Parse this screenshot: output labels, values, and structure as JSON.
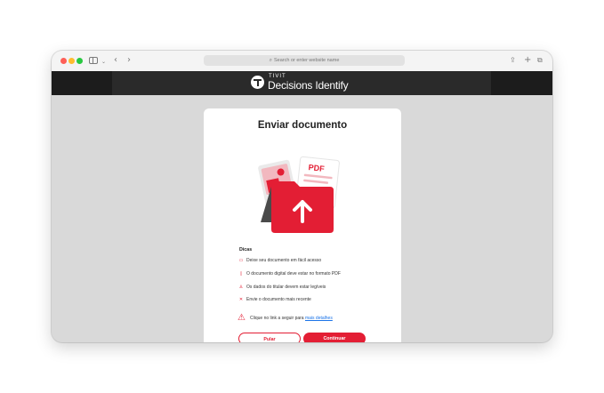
{
  "browser": {
    "url_placeholder": "Search or enter website name"
  },
  "header": {
    "brand_top": "TIVIT",
    "brand_bottom": "Decisions Identify"
  },
  "card": {
    "title": "Enviar documento",
    "illustration_label": "PDF",
    "tips_title": "Dicas",
    "tips": [
      {
        "icon": "folder-icon",
        "text": "Deixe seu documento em fácil acesso"
      },
      {
        "icon": "document-icon",
        "text": "O documento digital deve estar no formato PDF"
      },
      {
        "icon": "person-icon",
        "text": "Os dados do titular devem estar legíveis"
      },
      {
        "icon": "x-icon",
        "text": "Envie o documento mais recente"
      }
    ],
    "warning_text": "Clique no link a seguir para ",
    "warning_link": "mais detalhes",
    "skip_label": "Pular",
    "continue_label": "Continuar"
  },
  "colors": {
    "accent": "#e31e34",
    "header_bg": "#2a2a2a",
    "page_bg": "#d9d9d9"
  }
}
